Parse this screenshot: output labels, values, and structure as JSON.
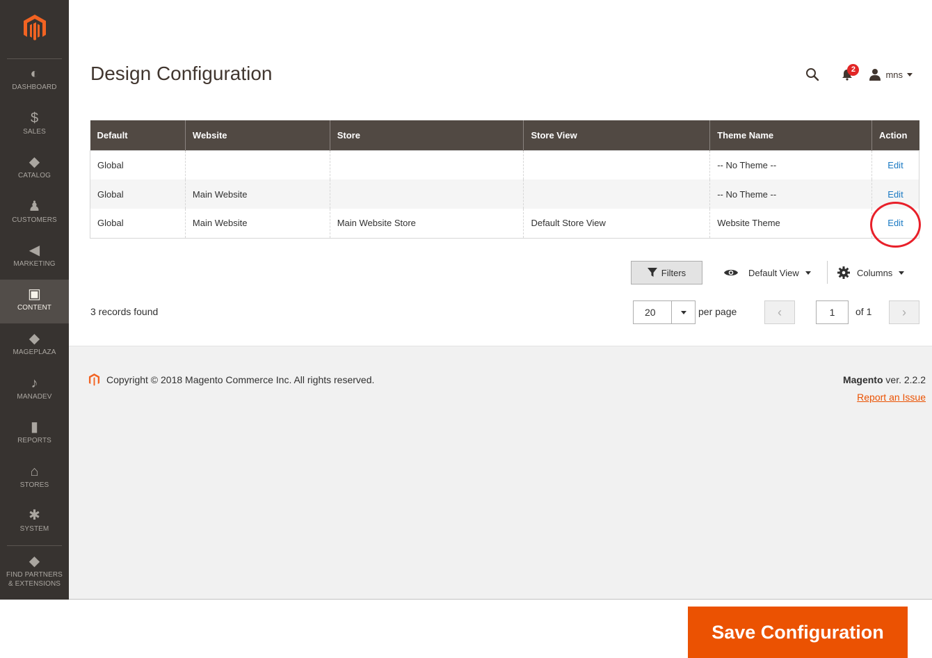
{
  "sidebar": {
    "items": [
      {
        "label": "DASHBOARD",
        "icon": "dashboard-icon",
        "glyph": "◐"
      },
      {
        "label": "SALES",
        "icon": "dollar-icon",
        "glyph": "$"
      },
      {
        "label": "CATALOG",
        "icon": "cube-icon",
        "glyph": "◆"
      },
      {
        "label": "CUSTOMERS",
        "icon": "person-icon",
        "glyph": "♟"
      },
      {
        "label": "MARKETING",
        "icon": "megaphone-icon",
        "glyph": "◀"
      },
      {
        "label": "CONTENT",
        "icon": "layout-icon",
        "glyph": "▣"
      },
      {
        "label": "MAGEPLAZA",
        "icon": "cube-icon",
        "glyph": "◆"
      },
      {
        "label": "MANADEV",
        "icon": "music-note-icon",
        "glyph": "♪"
      },
      {
        "label": "REPORTS",
        "icon": "bar-chart-icon",
        "glyph": "▮"
      },
      {
        "label": "STORES",
        "icon": "storefront-icon",
        "glyph": "⌂"
      },
      {
        "label": "SYSTEM",
        "icon": "gear-icon",
        "glyph": "✱"
      },
      {
        "label": "FIND PARTNERS",
        "label2": "& EXTENSIONS",
        "icon": "blocks-icon",
        "glyph": "◆"
      }
    ],
    "active": "CONTENT"
  },
  "header": {
    "title": "Design Configuration",
    "notification_count": "2",
    "user_name": "mns"
  },
  "grid": {
    "columns": [
      "Default",
      "Website",
      "Store",
      "Store View",
      "Theme Name",
      "Action"
    ],
    "rows": [
      [
        "Global",
        "",
        "",
        "",
        "-- No Theme --",
        "Edit"
      ],
      [
        "Global",
        "Main Website",
        "",
        "",
        "-- No Theme --",
        "Edit"
      ],
      [
        "Global",
        "Main Website",
        "Main Website Store",
        "Default Store View",
        "Website Theme",
        "Edit"
      ]
    ]
  },
  "toolbar": {
    "filters_label": "Filters",
    "view_label": "Default View",
    "columns_label": "Columns",
    "records_found": "3 records found",
    "per_page_value": "20",
    "per_page_label": "per page",
    "current_page": "1",
    "page_of": "of 1",
    "prev_glyph": "‹",
    "next_glyph": "›"
  },
  "footer": {
    "copyright": "Copyright © 2018 Magento Commerce Inc. All rights reserved.",
    "brand": "Magento",
    "version": " ver. 2.2.2",
    "report_link": "Report an Issue"
  },
  "actions": {
    "save_label": "Save Configuration"
  },
  "colors": {
    "accent": "#eb5202",
    "sidebar_bg": "#373330",
    "grid_header_bg": "#514943",
    "link": "#1979c3",
    "highlight": "#e8202a"
  }
}
